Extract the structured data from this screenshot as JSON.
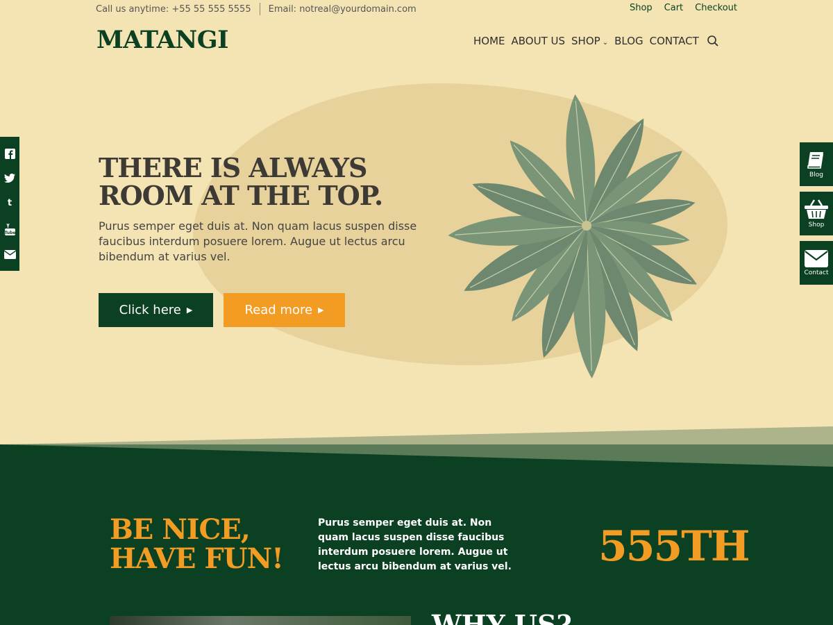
{
  "topbar": {
    "phone": "Call us anytime: +55 55 555 5555",
    "email": "Email: notreal@yourdomain.com",
    "links": [
      "Shop",
      "Cart",
      "Checkout"
    ]
  },
  "header": {
    "logo": "MATANGI",
    "nav": [
      "HOME",
      "ABOUT US",
      "SHOP",
      "BLOG",
      "CONTACT"
    ]
  },
  "hero": {
    "title_line1": "THERE IS ALWAYS",
    "title_line2": "ROOM AT THE TOP.",
    "text": "Purus semper eget duis at. Non quam lacus suspen disse faucibus interdum posuere lorem. Augue ut lectus arcu bibendum at varius vel.",
    "primary_button": "Click here",
    "secondary_button": "Read more"
  },
  "social": [
    "facebook-icon",
    "twitter-icon",
    "tumblr-icon",
    "youtube-icon",
    "email-icon"
  ],
  "side_tabs": [
    {
      "label": "Blog",
      "icon": "book-icon"
    },
    {
      "label": "Shop",
      "icon": "basket-icon"
    },
    {
      "label": "Contact",
      "icon": "envelope-icon"
    }
  ],
  "section2": {
    "heading_line1": "BE NICE,",
    "heading_line2": "HAVE FUN!",
    "text": "Purus semper eget duis at. Non quam lacus suspen disse faucibus interdum posuere lorem. Augue ut lectus arcu bibendum at varius vel.",
    "stat": "555TH",
    "why_heading": "WHY US?"
  },
  "colors": {
    "background": "#f4e3b3",
    "brand_green": "#0b4122",
    "accent_orange": "#f39c24",
    "blob": "#e8d29c"
  }
}
